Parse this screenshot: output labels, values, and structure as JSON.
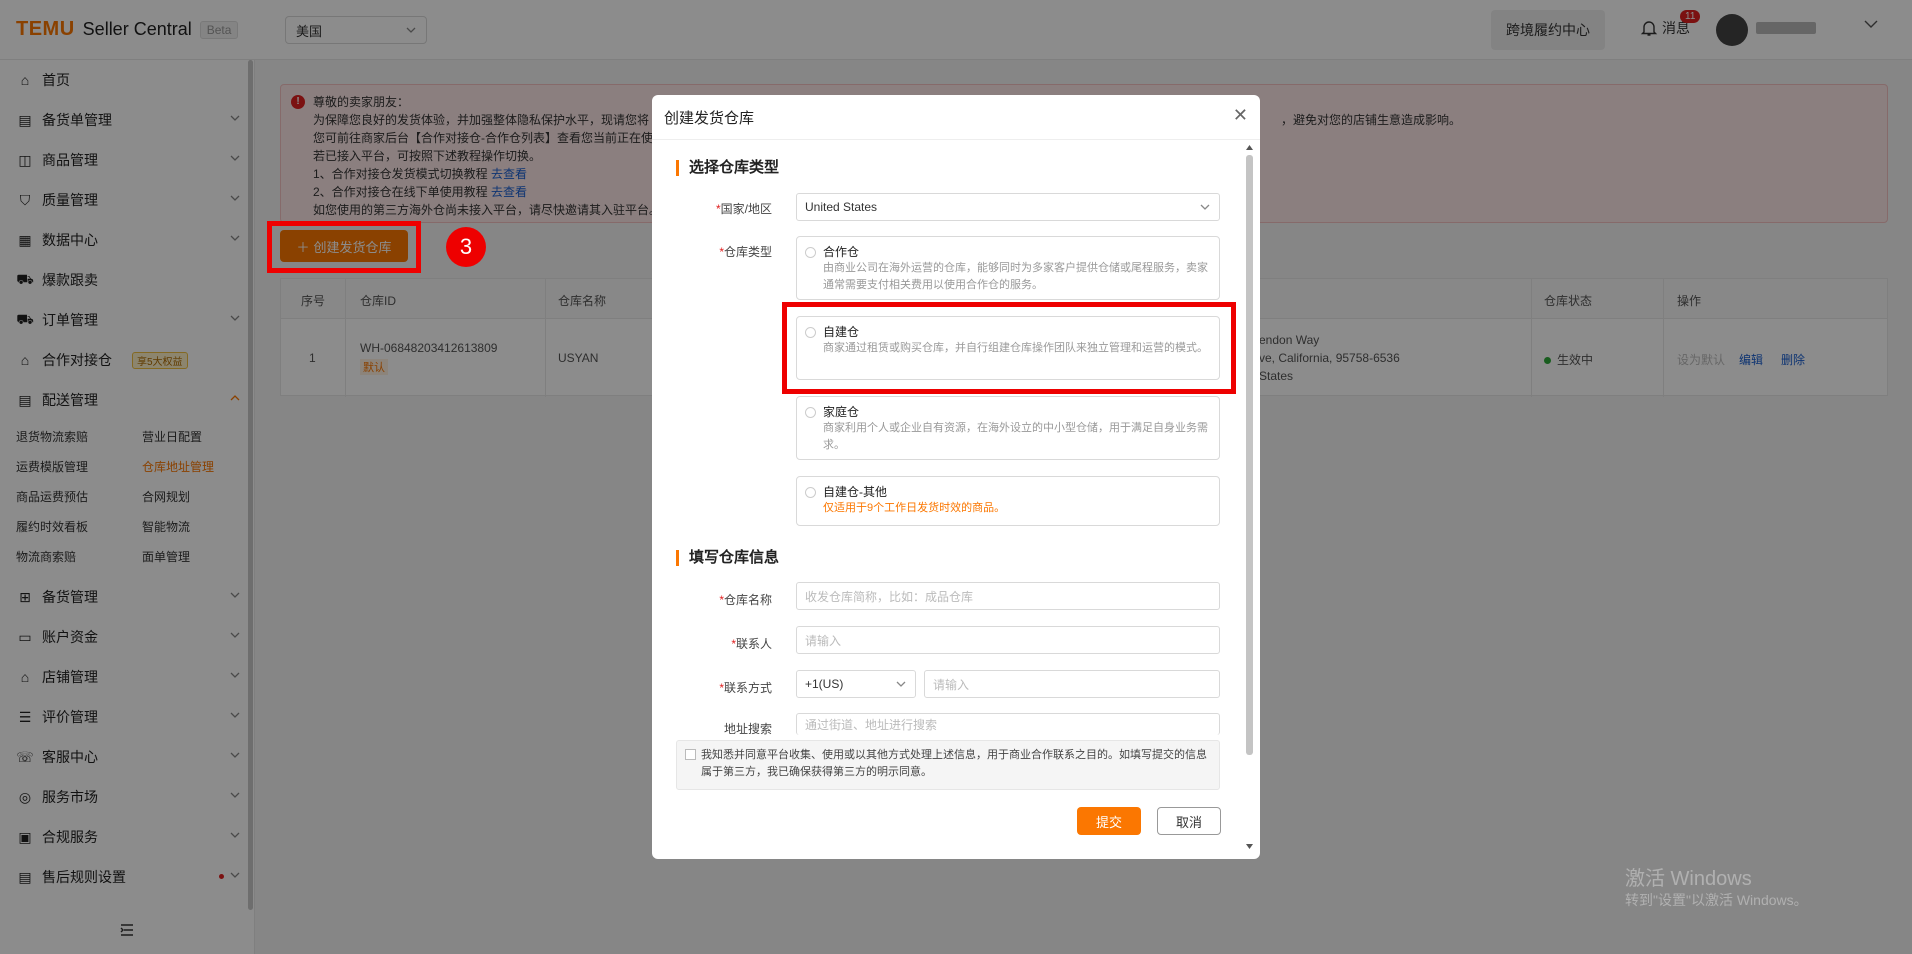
{
  "header": {
    "logo_brand": "TEMU",
    "logo_product": "Seller Central",
    "logo_badge": "Beta",
    "region": "美国",
    "cross_border_btn": "跨境履约中心",
    "messages_label": "消息",
    "messages_count": "11"
  },
  "sidebar": {
    "items": [
      {
        "label": "首页",
        "icon": "home-icon"
      },
      {
        "label": "备货单管理",
        "icon": "clipboard-icon"
      },
      {
        "label": "商品管理",
        "icon": "bag-icon"
      },
      {
        "label": "质量管理",
        "icon": "shield-icon"
      },
      {
        "label": "数据中心",
        "icon": "data-icon"
      },
      {
        "label": "爆款跟卖",
        "icon": "flame-cart-icon"
      },
      {
        "label": "订单管理",
        "icon": "cart-icon"
      },
      {
        "label": "合作对接仓",
        "icon": "warehouse-icon",
        "badge": "享5大权益"
      },
      {
        "label": "配送管理",
        "icon": "delivery-icon"
      },
      {
        "label": "备货管理",
        "icon": "stock-icon"
      },
      {
        "label": "账户资金",
        "icon": "wallet-icon"
      },
      {
        "label": "店铺管理",
        "icon": "store-icon"
      },
      {
        "label": "评价管理",
        "icon": "review-icon"
      },
      {
        "label": "客服中心",
        "icon": "headset-icon"
      },
      {
        "label": "服务市场",
        "icon": "market-icon"
      },
      {
        "label": "合规服务",
        "icon": "compliance-icon"
      },
      {
        "label": "售后规则设置",
        "icon": "rules-icon"
      }
    ],
    "sub_items": [
      {
        "label": "退货物流索赔"
      },
      {
        "label": "营业日配置"
      },
      {
        "label": "运费模版管理"
      },
      {
        "label": "仓库地址管理"
      },
      {
        "label": "商品运费预估"
      },
      {
        "label": "合网规划"
      },
      {
        "label": "履约时效看板"
      },
      {
        "label": "智能物流"
      },
      {
        "label": "物流商索赔"
      },
      {
        "label": "面单管理"
      }
    ]
  },
  "notice": {
    "greeting": "尊敬的卖家朋友：",
    "line1": "为保障您良好的发货体验，并加强整体隐私保护水平，现请您将",
    "line1_tail": "，避免对您的店铺生意造成影响。",
    "line2": "您可前往商家后台【合作对接仓-合作仓列表】查看您当前正在使",
    "line3": "若已接入平台，可按照下述教程操作切换。",
    "line4": "1、合作对接仓发货模式切换教程",
    "line5": "2、合作对接仓在线下单使用教程",
    "line6": "如您使用的第三方海外仓尚未接入平台，请尽快邀请其入驻平台。",
    "link": "去查看"
  },
  "main": {
    "create_btn": "创建发货仓库",
    "step_number": "3"
  },
  "table": {
    "headers": [
      "序号",
      "仓库ID",
      "仓库名称",
      "仓库状态",
      "操作"
    ],
    "row": {
      "index": "1",
      "id": "WH-06848203412613809",
      "default_tag": "默认",
      "name": "USYAN",
      "addr1": "endon Way",
      "addr2": "ve, California, 95758-6536",
      "addr3": "States",
      "status": "生效中",
      "op_default": "设为默认",
      "op_edit": "编辑",
      "op_delete": "删除"
    }
  },
  "modal": {
    "title": "创建发货仓库",
    "section1": "选择仓库类型",
    "country_label": "国家/地区",
    "country_value": "United States",
    "type_label": "仓库类型",
    "types": [
      {
        "name": "合作仓",
        "desc": "由商业公司在海外运营的仓库，能够同时为多家客户提供仓储或尾程服务，卖家通常需要支付相关费用以使用合作仓的服务。"
      },
      {
        "name": "自建仓",
        "desc": "商家通过租赁或购买仓库，并自行组建仓库操作团队来独立管理和运营的模式。"
      },
      {
        "name": "家庭仓",
        "desc": "商家利用个人或企业自有资源，在海外设立的中小型仓储，用于满足自身业务需求。"
      },
      {
        "name": "自建仓-其他",
        "desc": "仅适用于9个工作日发货时效的商品。"
      }
    ],
    "section2": "填写仓库信息",
    "wh_name_label": "仓库名称",
    "wh_name_placeholder": "收发仓库简称，比如：成品仓库",
    "contact_label": "联系人",
    "contact_placeholder": "请输入",
    "contact_method_label": "联系方式",
    "phone_code": "+1(US)",
    "phone_placeholder": "请输入",
    "address_label": "地址搜索",
    "address_placeholder": "通过街道、地址进行搜索",
    "consent": "我知悉并同意平台收集、使用或以其他方式处理上述信息，用于商业合作联系之目的。如填写提交的信息属于第三方，我已确保获得第三方的明示同意。",
    "submit": "提交",
    "cancel": "取消"
  },
  "watermark": {
    "line1": "激活 Windows",
    "line2": "转到\"设置\"以激活 Windows。"
  },
  "colors": {
    "brand": "#fb7701",
    "highlight": "#e00000",
    "status_green": "#2eaa3a"
  }
}
